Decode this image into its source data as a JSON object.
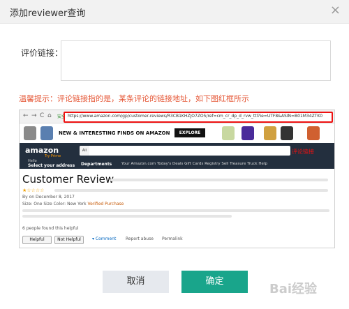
{
  "dialog": {
    "title": "添加reviewer查询",
    "close_symbol": "×",
    "field_label": "评价链接：",
    "hint": "温馨提示：评论链接指的是，某条评论的链接地址，如下图红框所示"
  },
  "example": {
    "browser": {
      "back": "←",
      "forward": "→",
      "reload": "C",
      "home": "⌂",
      "secure_label": "安全",
      "url": "https://www.amazon.com/gp/customer-reviews/R3CB1KHZJO7ZO5/ref=cm_cr_dp_d_rvw_ttl?ie=UTF8&ASIN=B01M34ZTK0"
    },
    "banner": {
      "text": "NEW & INTERESTING FINDS ON AMAZON",
      "explore": "EXPLORE"
    },
    "amazon": {
      "logo": "amazon",
      "logo_sub": "Try Prime",
      "search_scope": "All",
      "annotation": "评论链接",
      "hello": "Hello",
      "address": "Select your address",
      "departments": "Departments",
      "nav_links": "Your Amazon.com   Today's Deals   Gift Cards   Registry   Sell   Treasure Truck   Help"
    },
    "review": {
      "title": "Customer Review",
      "stars": "★☆☆☆☆",
      "by_line": "By            on December 8, 2017",
      "meta_prefix": "Size: One Size   Color: New York   ",
      "verified": "Verified Purchase",
      "helpful_count": "6 people found this helpful",
      "helpful_button": "Helpful",
      "not_helpful_button": "Not Helpful",
      "comment": "▾ Comment",
      "report": "Report abuse",
      "permalink": "Permalink"
    }
  },
  "buttons": {
    "cancel": "取消",
    "ok": "确定"
  },
  "watermark": "Bai经验",
  "colors": {
    "hint": "#e65a3a",
    "ok_button": "#19a58b",
    "cancel_button": "#e6e9ee",
    "highlight": "#ee1111"
  }
}
